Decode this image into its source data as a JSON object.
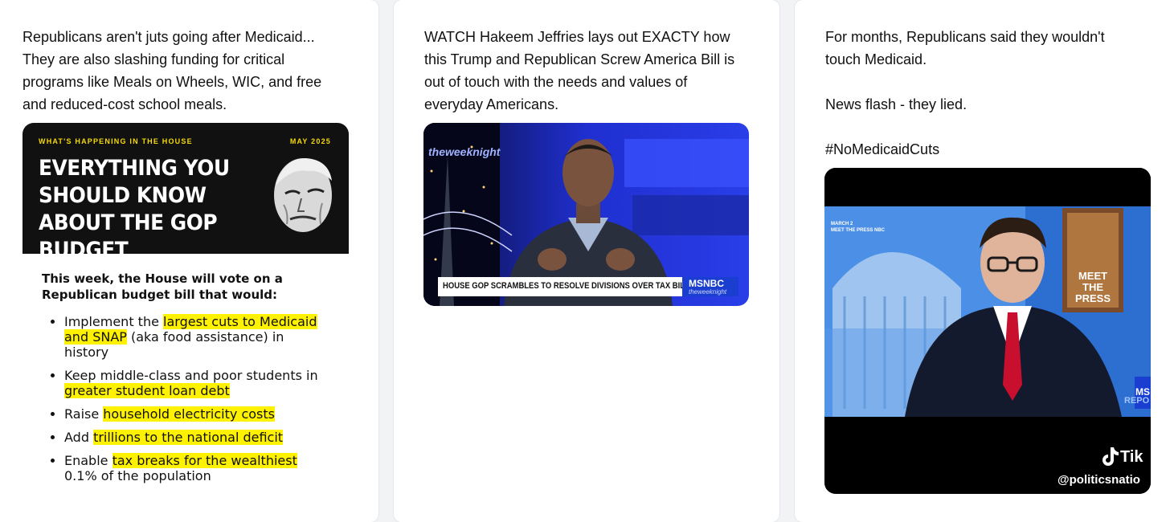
{
  "posts": [
    {
      "text": "Republicans aren't juts going after Medicaid...\nThey are also slashing funding for critical\nprograms like Meals on Wheels, WIC, and free\nand reduced-cost school meals.",
      "infographic": {
        "kicker": "WHAT'S HAPPENING IN THE HOUSE",
        "date": "MAY 2025",
        "title": "EVERYTHING YOU SHOULD KNOW ABOUT THE GOP BUDGET",
        "lede": "This week, the House will vote on a Republican budget bill that would:",
        "bullets": [
          {
            "pre": "Implement the ",
            "hl": "largest cuts to Medicaid and SNAP",
            "post": " (aka food assistance) in history"
          },
          {
            "pre": "Keep middle-class and poor students in ",
            "hl": "greater student loan debt",
            "post": ""
          },
          {
            "pre": "Raise ",
            "hl": "household electricity costs",
            "post": ""
          },
          {
            "pre": "Add ",
            "hl": "trillions to the national deficit",
            "post": ""
          },
          {
            "pre": "Enable ",
            "hl": "tax breaks for the wealthiest",
            "post": " 0.1% of the population"
          }
        ]
      }
    },
    {
      "text": "WATCH Hakeem Jeffries lays out EXACTY how\nthis Trump and Republican Screw America Bill is\nout of touch with the needs and values of\neveryday Americans.",
      "video": {
        "show_logo": "theweeknight",
        "chyron": "HOUSE GOP SCRAMBLES TO RESOLVE DIVISIONS OVER TAX BILL",
        "network": "MSNBC",
        "network_sub": "theweeknight"
      }
    },
    {
      "text": "For months, Republicans said they wouldn't\ntouch Medicaid.\n\nNews flash - they lied.\n\n#NoMedicaidCuts",
      "video": {
        "date_tag": "MARCH 2\nMEET THE PRESS NBC",
        "show_sign": "MEET THE PRESS",
        "network_fragment": "MS",
        "report_fragment": "REPO",
        "tiktok_label": "Tik",
        "handle": "@politicsnatio"
      }
    }
  ],
  "colors": {
    "highlight": "#fff200",
    "msnbc_blue": "#1a3fd0",
    "kicker_yellow": "#f5d90a"
  }
}
